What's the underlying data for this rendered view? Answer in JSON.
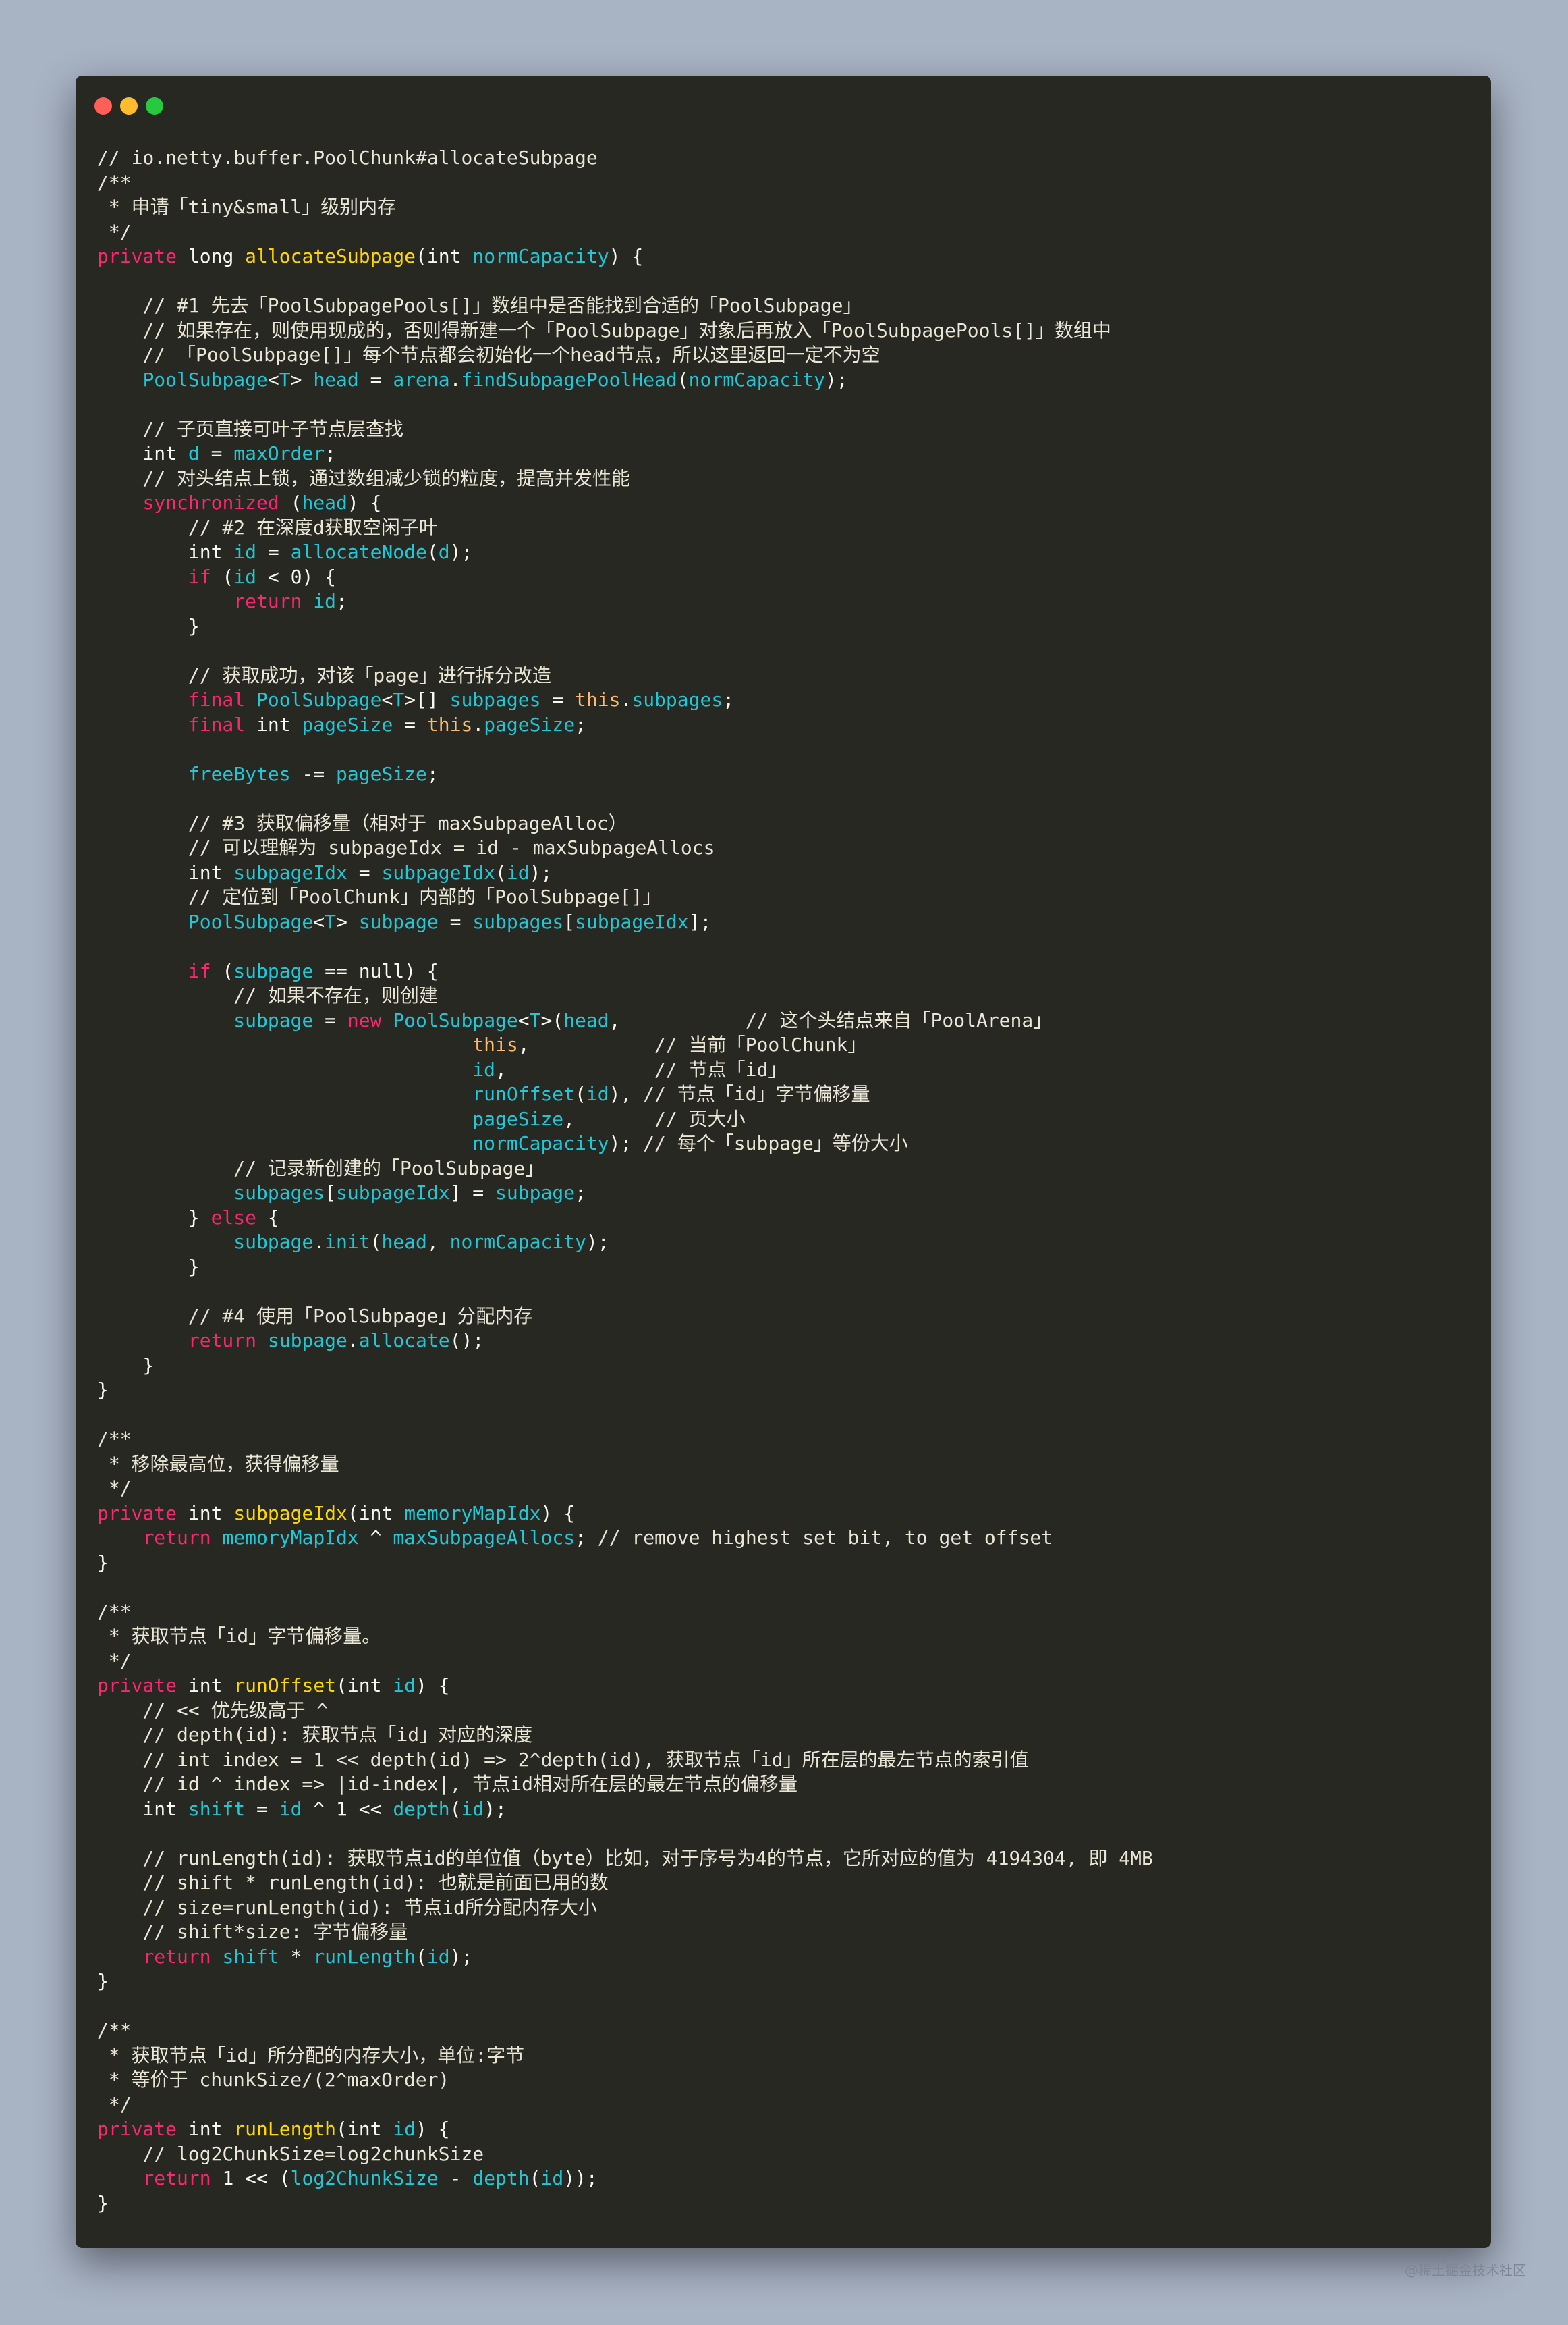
{
  "colors": {
    "background": "#a8b3c4",
    "window": "#272822",
    "comment": "#e9e6d6",
    "keyword": "#f92672",
    "function": "#ffd500",
    "variable": "#21c7d7",
    "this": "#ffb86c"
  },
  "watermark": "@稀土掘金技术社区",
  "code_lines": [
    [
      [
        "c",
        "// io.netty.buffer.PoolChunk#allocateSubpage"
      ]
    ],
    [
      [
        "c",
        "/**"
      ]
    ],
    [
      [
        "c",
        " * 申请「tiny&small」级别内存"
      ]
    ],
    [
      [
        "c",
        " */"
      ]
    ],
    [
      [
        "k",
        "private"
      ],
      [
        "t",
        " long "
      ],
      [
        "f",
        "allocateSubpage"
      ],
      [
        "x",
        "("
      ],
      [
        "t",
        "int "
      ],
      [
        "v",
        "normCapacity"
      ],
      [
        "x",
        ") {"
      ]
    ],
    [],
    [
      [
        "c",
        "    // #1 先去「PoolSubpagePools[]」数组中是否能找到合适的「PoolSubpage」"
      ]
    ],
    [
      [
        "c",
        "    // 如果存在，则使用现成的，否则得新建一个「PoolSubpage」对象后再放入「PoolSubpagePools[]」数组中"
      ]
    ],
    [
      [
        "c",
        "    // 「PoolSubpage[]」每个节点都会初始化一个head节点，所以这里返回一定不为空"
      ]
    ],
    [
      [
        "x",
        "    "
      ],
      [
        "v",
        "PoolSubpage"
      ],
      [
        "x",
        "<"
      ],
      [
        "v",
        "T"
      ],
      [
        "x",
        "> "
      ],
      [
        "v",
        "head"
      ],
      [
        "x",
        " = "
      ],
      [
        "v",
        "arena"
      ],
      [
        "x",
        "."
      ],
      [
        "v",
        "findSubpagePoolHead"
      ],
      [
        "x",
        "("
      ],
      [
        "v",
        "normCapacity"
      ],
      [
        "x",
        ");"
      ]
    ],
    [],
    [
      [
        "c",
        "    // 子页直接可叶子节点层查找"
      ]
    ],
    [
      [
        "t",
        "    int "
      ],
      [
        "v",
        "d"
      ],
      [
        "x",
        " = "
      ],
      [
        "v",
        "maxOrder"
      ],
      [
        "x",
        ";"
      ]
    ],
    [
      [
        "c",
        "    // 对头结点上锁，通过数组减少锁的粒度，提高并发性能"
      ]
    ],
    [
      [
        "x",
        "    "
      ],
      [
        "k",
        "synchronized"
      ],
      [
        "x",
        " ("
      ],
      [
        "v",
        "head"
      ],
      [
        "x",
        ") {"
      ]
    ],
    [
      [
        "c",
        "        // #2 在深度d获取空闲子叶"
      ]
    ],
    [
      [
        "t",
        "        int "
      ],
      [
        "v",
        "id"
      ],
      [
        "x",
        " = "
      ],
      [
        "v",
        "allocateNode"
      ],
      [
        "x",
        "("
      ],
      [
        "v",
        "d"
      ],
      [
        "x",
        ");"
      ]
    ],
    [
      [
        "x",
        "        "
      ],
      [
        "k",
        "if"
      ],
      [
        "x",
        " ("
      ],
      [
        "v",
        "id"
      ],
      [
        "x",
        " < "
      ],
      [
        "n",
        "0"
      ],
      [
        "x",
        ") {"
      ]
    ],
    [
      [
        "x",
        "            "
      ],
      [
        "k",
        "return"
      ],
      [
        "x",
        " "
      ],
      [
        "v",
        "id"
      ],
      [
        "x",
        ";"
      ]
    ],
    [
      [
        "x",
        "        }"
      ]
    ],
    [],
    [
      [
        "c",
        "        // 获取成功，对该「page」进行拆分改造"
      ]
    ],
    [
      [
        "x",
        "        "
      ],
      [
        "k",
        "final"
      ],
      [
        "x",
        " "
      ],
      [
        "v",
        "PoolSubpage"
      ],
      [
        "x",
        "<"
      ],
      [
        "v",
        "T"
      ],
      [
        "x",
        ">[] "
      ],
      [
        "v",
        "subpages"
      ],
      [
        "x",
        " = "
      ],
      [
        "s",
        "this"
      ],
      [
        "x",
        "."
      ],
      [
        "v",
        "subpages"
      ],
      [
        "x",
        ";"
      ]
    ],
    [
      [
        "x",
        "        "
      ],
      [
        "k",
        "final"
      ],
      [
        "t",
        " int "
      ],
      [
        "v",
        "pageSize"
      ],
      [
        "x",
        " = "
      ],
      [
        "s",
        "this"
      ],
      [
        "x",
        "."
      ],
      [
        "v",
        "pageSize"
      ],
      [
        "x",
        ";"
      ]
    ],
    [],
    [
      [
        "x",
        "        "
      ],
      [
        "v",
        "freeBytes"
      ],
      [
        "x",
        " -= "
      ],
      [
        "v",
        "pageSize"
      ],
      [
        "x",
        ";"
      ]
    ],
    [],
    [
      [
        "c",
        "        // #3 获取偏移量（相对于 maxSubpageAlloc）"
      ]
    ],
    [
      [
        "c",
        "        // 可以理解为 subpageIdx = id - maxSubpageAllocs"
      ]
    ],
    [
      [
        "t",
        "        int "
      ],
      [
        "v",
        "subpageIdx"
      ],
      [
        "x",
        " = "
      ],
      [
        "v",
        "subpageIdx"
      ],
      [
        "x",
        "("
      ],
      [
        "v",
        "id"
      ],
      [
        "x",
        ");"
      ]
    ],
    [
      [
        "c",
        "        // 定位到「PoolChunk」内部的「PoolSubpage[]」"
      ]
    ],
    [
      [
        "x",
        "        "
      ],
      [
        "v",
        "PoolSubpage"
      ],
      [
        "x",
        "<"
      ],
      [
        "v",
        "T"
      ],
      [
        "x",
        "> "
      ],
      [
        "v",
        "subpage"
      ],
      [
        "x",
        " = "
      ],
      [
        "v",
        "subpages"
      ],
      [
        "x",
        "["
      ],
      [
        "v",
        "subpageIdx"
      ],
      [
        "x",
        "];"
      ]
    ],
    [],
    [
      [
        "x",
        "        "
      ],
      [
        "k",
        "if"
      ],
      [
        "x",
        " ("
      ],
      [
        "v",
        "subpage"
      ],
      [
        "x",
        " == "
      ],
      [
        "t",
        "null"
      ],
      [
        "x",
        ") {"
      ]
    ],
    [
      [
        "c",
        "            // 如果不存在，则创建"
      ]
    ],
    [
      [
        "x",
        "            "
      ],
      [
        "v",
        "subpage"
      ],
      [
        "x",
        " = "
      ],
      [
        "k",
        "new"
      ],
      [
        "x",
        " "
      ],
      [
        "v",
        "PoolSubpage"
      ],
      [
        "x",
        "<"
      ],
      [
        "v",
        "T"
      ],
      [
        "x",
        ">("
      ],
      [
        "v",
        "head"
      ],
      [
        "x",
        ",           "
      ],
      [
        "c",
        "// 这个头结点来自「PoolArena」"
      ]
    ],
    [
      [
        "x",
        "                                 "
      ],
      [
        "s",
        "this"
      ],
      [
        "x",
        ",           "
      ],
      [
        "c",
        "// 当前「PoolChunk」"
      ]
    ],
    [
      [
        "x",
        "                                 "
      ],
      [
        "v",
        "id"
      ],
      [
        "x",
        ",             "
      ],
      [
        "c",
        "// 节点「id」"
      ]
    ],
    [
      [
        "x",
        "                                 "
      ],
      [
        "v",
        "runOffset"
      ],
      [
        "x",
        "("
      ],
      [
        "v",
        "id"
      ],
      [
        "x",
        "), "
      ],
      [
        "c",
        "// 节点「id」字节偏移量"
      ]
    ],
    [
      [
        "x",
        "                                 "
      ],
      [
        "v",
        "pageSize"
      ],
      [
        "x",
        ",       "
      ],
      [
        "c",
        "// 页大小"
      ]
    ],
    [
      [
        "x",
        "                                 "
      ],
      [
        "v",
        "normCapacity"
      ],
      [
        "x",
        "); "
      ],
      [
        "c",
        "// 每个「subpage」等份大小"
      ]
    ],
    [
      [
        "c",
        "            // 记录新创建的「PoolSubpage」"
      ]
    ],
    [
      [
        "x",
        "            "
      ],
      [
        "v",
        "subpages"
      ],
      [
        "x",
        "["
      ],
      [
        "v",
        "subpageIdx"
      ],
      [
        "x",
        "] = "
      ],
      [
        "v",
        "subpage"
      ],
      [
        "x",
        ";"
      ]
    ],
    [
      [
        "x",
        "        } "
      ],
      [
        "k",
        "else"
      ],
      [
        "x",
        " {"
      ]
    ],
    [
      [
        "x",
        "            "
      ],
      [
        "v",
        "subpage"
      ],
      [
        "x",
        "."
      ],
      [
        "v",
        "init"
      ],
      [
        "x",
        "("
      ],
      [
        "v",
        "head"
      ],
      [
        "x",
        ", "
      ],
      [
        "v",
        "normCapacity"
      ],
      [
        "x",
        ");"
      ]
    ],
    [
      [
        "x",
        "        }"
      ]
    ],
    [],
    [
      [
        "c",
        "        // #4 使用「PoolSubpage」分配内存"
      ]
    ],
    [
      [
        "x",
        "        "
      ],
      [
        "k",
        "return"
      ],
      [
        "x",
        " "
      ],
      [
        "v",
        "subpage"
      ],
      [
        "x",
        "."
      ],
      [
        "v",
        "allocate"
      ],
      [
        "x",
        "();"
      ]
    ],
    [
      [
        "x",
        "    }"
      ]
    ],
    [
      [
        "x",
        "}"
      ]
    ],
    [],
    [
      [
        "c",
        "/**"
      ]
    ],
    [
      [
        "c",
        " * 移除最高位，获得偏移量"
      ]
    ],
    [
      [
        "c",
        " */"
      ]
    ],
    [
      [
        "k",
        "private"
      ],
      [
        "t",
        " int "
      ],
      [
        "f",
        "subpageIdx"
      ],
      [
        "x",
        "("
      ],
      [
        "t",
        "int "
      ],
      [
        "v",
        "memoryMapIdx"
      ],
      [
        "x",
        ") {"
      ]
    ],
    [
      [
        "x",
        "    "
      ],
      [
        "k",
        "return"
      ],
      [
        "x",
        " "
      ],
      [
        "v",
        "memoryMapIdx"
      ],
      [
        "x",
        " ^ "
      ],
      [
        "v",
        "maxSubpageAllocs"
      ],
      [
        "x",
        "; "
      ],
      [
        "c",
        "// remove highest set bit, to get offset"
      ]
    ],
    [
      [
        "x",
        "}"
      ]
    ],
    [],
    [
      [
        "c",
        "/**"
      ]
    ],
    [
      [
        "c",
        " * 获取节点「id」字节偏移量。"
      ]
    ],
    [
      [
        "c",
        " */"
      ]
    ],
    [
      [
        "k",
        "private"
      ],
      [
        "t",
        " int "
      ],
      [
        "f",
        "runOffset"
      ],
      [
        "x",
        "("
      ],
      [
        "t",
        "int "
      ],
      [
        "v",
        "id"
      ],
      [
        "x",
        ") {"
      ]
    ],
    [
      [
        "c",
        "    // << 优先级高于 ^"
      ]
    ],
    [
      [
        "c",
        "    // depth(id): 获取节点「id」对应的深度"
      ]
    ],
    [
      [
        "c",
        "    // int index = 1 << depth(id) => 2^depth(id), 获取节点「id」所在层的最左节点的索引值"
      ]
    ],
    [
      [
        "c",
        "    // id ^ index => |id-index|, 节点id相对所在层的最左节点的偏移量"
      ]
    ],
    [
      [
        "t",
        "    int "
      ],
      [
        "v",
        "shift"
      ],
      [
        "x",
        " = "
      ],
      [
        "v",
        "id"
      ],
      [
        "x",
        " ^ "
      ],
      [
        "n",
        "1"
      ],
      [
        "x",
        " << "
      ],
      [
        "v",
        "depth"
      ],
      [
        "x",
        "("
      ],
      [
        "v",
        "id"
      ],
      [
        "x",
        ");"
      ]
    ],
    [],
    [
      [
        "c",
        "    // runLength(id): 获取节点id的单位值（byte）比如，对于序号为4的节点，它所对应的值为 4194304, 即 4MB"
      ]
    ],
    [
      [
        "c",
        "    // shift * runLength(id): 也就是前面已用的数"
      ]
    ],
    [
      [
        "c",
        "    // size=runLength(id): 节点id所分配内存大小"
      ]
    ],
    [
      [
        "c",
        "    // shift*size: 字节偏移量"
      ]
    ],
    [
      [
        "x",
        "    "
      ],
      [
        "k",
        "return"
      ],
      [
        "x",
        " "
      ],
      [
        "v",
        "shift"
      ],
      [
        "x",
        " * "
      ],
      [
        "v",
        "runLength"
      ],
      [
        "x",
        "("
      ],
      [
        "v",
        "id"
      ],
      [
        "x",
        ");"
      ]
    ],
    [
      [
        "x",
        "}"
      ]
    ],
    [],
    [
      [
        "c",
        "/**"
      ]
    ],
    [
      [
        "c",
        " * 获取节点「id」所分配的内存大小，单位:字节"
      ]
    ],
    [
      [
        "c",
        " * 等价于 chunkSize/(2^maxOrder)"
      ]
    ],
    [
      [
        "c",
        " */"
      ]
    ],
    [
      [
        "k",
        "private"
      ],
      [
        "t",
        " int "
      ],
      [
        "f",
        "runLength"
      ],
      [
        "x",
        "("
      ],
      [
        "t",
        "int "
      ],
      [
        "v",
        "id"
      ],
      [
        "x",
        ") {"
      ]
    ],
    [
      [
        "c",
        "    // log2ChunkSize=log2chunkSize"
      ]
    ],
    [
      [
        "x",
        "    "
      ],
      [
        "k",
        "return"
      ],
      [
        "x",
        " "
      ],
      [
        "n",
        "1"
      ],
      [
        "x",
        " << ("
      ],
      [
        "v",
        "log2ChunkSize"
      ],
      [
        "x",
        " - "
      ],
      [
        "v",
        "depth"
      ],
      [
        "x",
        "("
      ],
      [
        "v",
        "id"
      ],
      [
        "x",
        "));"
      ]
    ],
    [
      [
        "x",
        "}"
      ]
    ]
  ]
}
